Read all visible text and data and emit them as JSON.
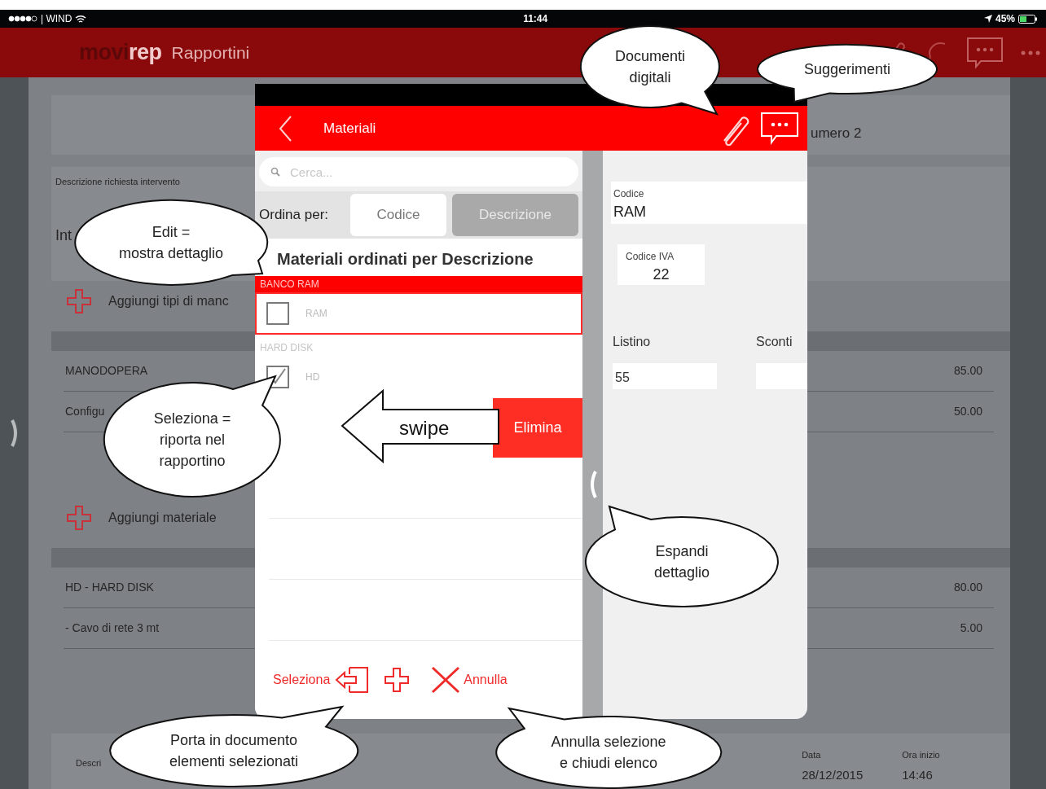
{
  "status_bar": {
    "carrier": "| WIND",
    "time": "11:44",
    "battery": "45%"
  },
  "app_bar": {
    "logo": [
      "movi",
      "rep"
    ],
    "title": "Rapportini"
  },
  "report": {
    "header_fragment": "umero 2",
    "request": {
      "label": "Descrizione richiesta intervento",
      "value": "Int"
    },
    "labor": {
      "add_label": "Aggiungi tipi di manc",
      "rows": [
        {
          "description": "MANODOPERA",
          "total": "85.00"
        },
        {
          "description": "Configu",
          "total": "50.00"
        }
      ]
    },
    "materials": {
      "add_label": "Aggiungi materiale",
      "rows": [
        {
          "description": "HD - HARD DISK",
          "total": "80.00"
        },
        {
          "description": "- Cavo di rete 3 mt",
          "total": "5.00"
        }
      ]
    },
    "footer": {
      "description_label": "Descri",
      "date_label": "Data",
      "date": "28/12/2015",
      "start_label": "Ora inizio",
      "start": "14:46"
    }
  },
  "picker": {
    "title": "Materiali",
    "search": {
      "placeholder": "Cerca..."
    },
    "sort_label": "Ordina per:",
    "sort_options": [
      {
        "label": "Codice",
        "selected": false
      },
      {
        "label": "Descrizione",
        "selected": true
      }
    ],
    "list_title": "Materiali ordinati per Descrizione",
    "groups": [
      {
        "header": "BANCO RAM",
        "selected": true,
        "items": [
          {
            "label": "RAM",
            "checked": false
          }
        ]
      },
      {
        "header": "HARD DISK",
        "selected": false,
        "items": [
          {
            "label": "HD",
            "checked": true
          }
        ]
      }
    ],
    "swipe_action": "Elimina",
    "toolbar": {
      "select": "Seleziona",
      "cancel": "Annulla"
    }
  },
  "detail": {
    "code_label": "Codice",
    "code": "RAM",
    "vat_label": "Codice IVA",
    "vat": "22",
    "price_label": "Listino",
    "price": "55",
    "discount_label": "Sconti"
  },
  "callouts": [
    {
      "lines": [
        "Documenti",
        "digitali"
      ]
    },
    {
      "lines": [
        "Suggerimenti"
      ]
    },
    {
      "lines": [
        "Edit =",
        "mostra dettaglio"
      ]
    },
    {
      "lines": [
        "Seleziona =",
        "riporta nel",
        "rapportino"
      ]
    },
    {
      "lines": [
        "Espandi",
        "dettaglio"
      ]
    },
    {
      "lines": [
        "Porta in documento",
        "elementi selezionati"
      ]
    },
    {
      "lines": [
        "Annulla selezione",
        "e chiudi elenco"
      ]
    }
  ],
  "swipe_hint": "swipe"
}
